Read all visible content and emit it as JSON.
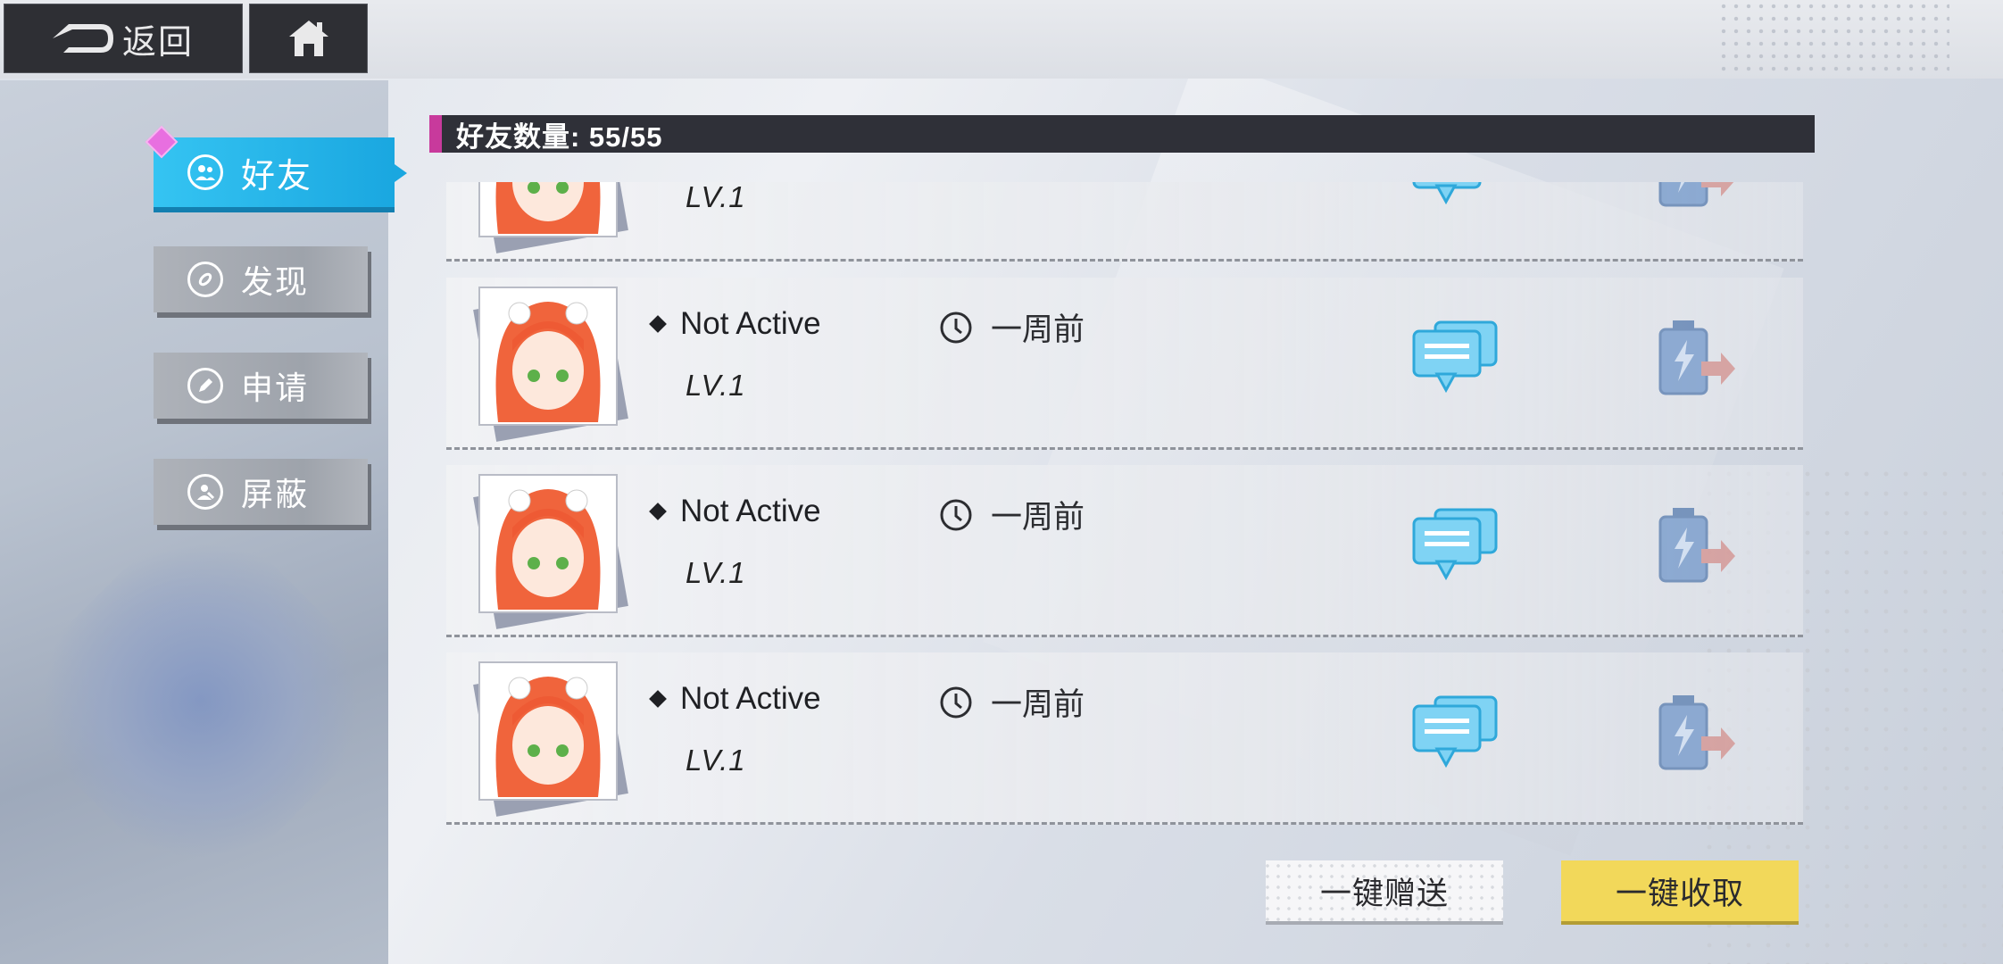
{
  "topbar": {
    "back_label": "返回",
    "icons": [
      "back-arrow-icon",
      "home-icon"
    ]
  },
  "sidebar": {
    "items": [
      {
        "label": "好友",
        "icon": "friends-icon",
        "active": true
      },
      {
        "label": "发现",
        "icon": "discover-icon",
        "active": false
      },
      {
        "label": "申请",
        "icon": "request-icon",
        "active": false
      },
      {
        "label": "屏蔽",
        "icon": "block-icon",
        "active": false
      }
    ]
  },
  "list_header": {
    "title": "好友数量: 55/55"
  },
  "friends": [
    {
      "status": "",
      "level": "LV.1",
      "last_seen": ""
    },
    {
      "status": "Not Active",
      "level": "LV.1",
      "last_seen": "一周前"
    },
    {
      "status": "Not Active",
      "level": "LV.1",
      "last_seen": "一周前"
    },
    {
      "status": "Not Active",
      "level": "LV.1",
      "last_seen": "一周前"
    }
  ],
  "actions": {
    "send_all": "一键赠送",
    "collect_all": "一键收取"
  },
  "colors": {
    "accent_blue": "#1aa7e0",
    "accent_pink": "#c83a9c",
    "collect_yellow": "#f2d85a",
    "header_dark": "#2f3038"
  }
}
